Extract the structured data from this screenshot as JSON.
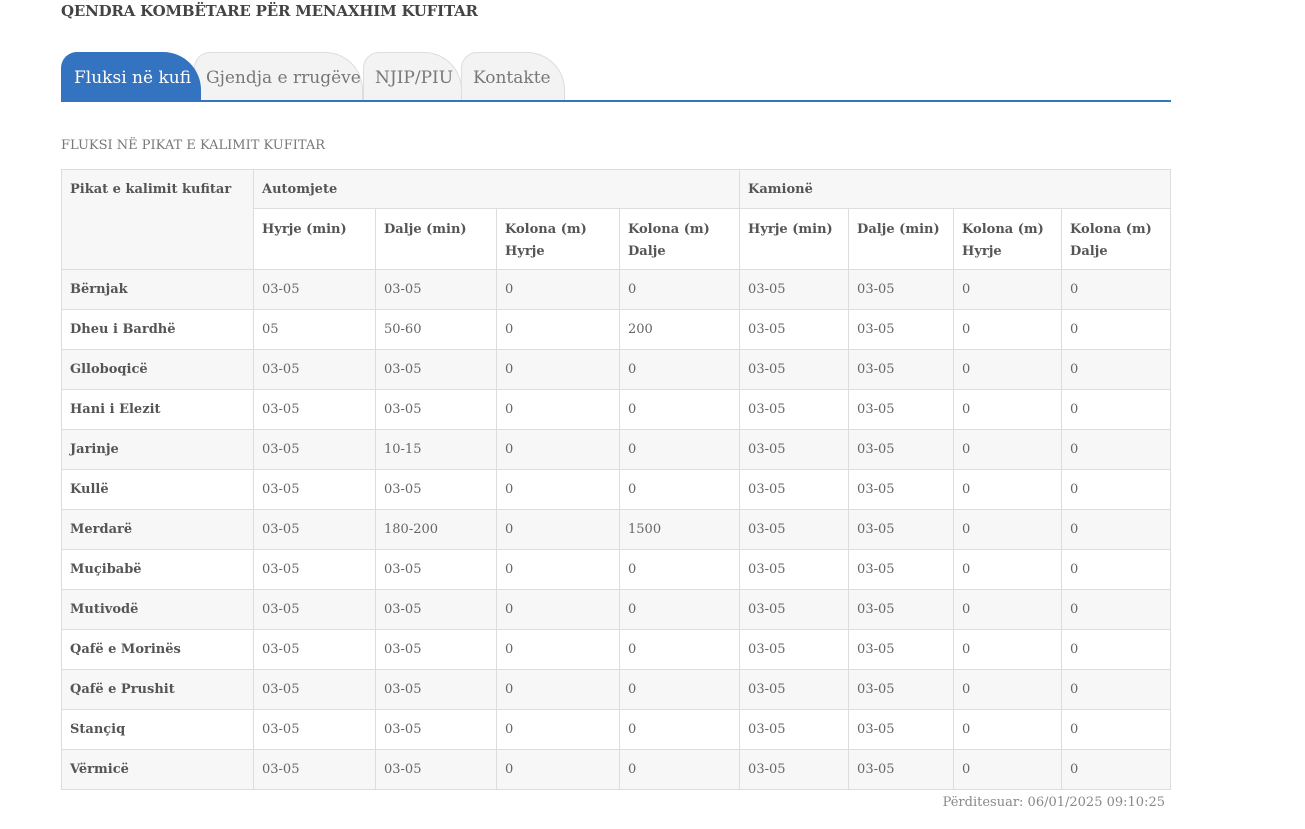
{
  "header": {
    "title": "QENDRA KOMBËTARE PËR MENAXHIM KUFITAR"
  },
  "tabs": [
    {
      "label": "Fluksi në kufi",
      "active": true
    },
    {
      "label": "Gjendja e rrugëve",
      "active": false
    },
    {
      "label": "NJIP/PIU",
      "active": false
    },
    {
      "label": "Kontakte",
      "active": false
    }
  ],
  "section_title": "FLUKSI NË PIKAT E KALIMIT KUFITAR",
  "table": {
    "first_header": "Pikat e kalimit kufitar",
    "groups": [
      "Automjete",
      "Kamionë"
    ],
    "columns": [
      "Hyrje (min)",
      "Dalje (min)",
      "Kolona (m) Hyrje",
      "Kolona (m) Dalje",
      "Hyrje (min)",
      "Dalje (min)",
      "Kolona (m) Hyrje",
      "Kolona (m) Dalje"
    ],
    "rows": [
      {
        "name": "Bërnjak",
        "values": [
          "03-05",
          "03-05",
          "0",
          "0",
          "03-05",
          "03-05",
          "0",
          "0"
        ]
      },
      {
        "name": "Dheu i Bardhë",
        "values": [
          "05",
          "50-60",
          "0",
          "200",
          "03-05",
          "03-05",
          "0",
          "0"
        ]
      },
      {
        "name": "Glloboqicë",
        "values": [
          "03-05",
          "03-05",
          "0",
          "0",
          "03-05",
          "03-05",
          "0",
          "0"
        ]
      },
      {
        "name": "Hani i Elezit",
        "values": [
          "03-05",
          "03-05",
          "0",
          "0",
          "03-05",
          "03-05",
          "0",
          "0"
        ]
      },
      {
        "name": "Jarinje",
        "values": [
          "03-05",
          "10-15",
          "0",
          "0",
          "03-05",
          "03-05",
          "0",
          "0"
        ]
      },
      {
        "name": "Kullë",
        "values": [
          "03-05",
          "03-05",
          "0",
          "0",
          "03-05",
          "03-05",
          "0",
          "0"
        ]
      },
      {
        "name": "Merdarë",
        "values": [
          "03-05",
          "180-200",
          "0",
          "1500",
          "03-05",
          "03-05",
          "0",
          "0"
        ]
      },
      {
        "name": "Muçibabë",
        "values": [
          "03-05",
          "03-05",
          "0",
          "0",
          "03-05",
          "03-05",
          "0",
          "0"
        ]
      },
      {
        "name": "Mutivodë",
        "values": [
          "03-05",
          "03-05",
          "0",
          "0",
          "03-05",
          "03-05",
          "0",
          "0"
        ]
      },
      {
        "name": "Qafë e Morinës",
        "values": [
          "03-05",
          "03-05",
          "0",
          "0",
          "03-05",
          "03-05",
          "0",
          "0"
        ]
      },
      {
        "name": "Qafë e Prushit",
        "values": [
          "03-05",
          "03-05",
          "0",
          "0",
          "03-05",
          "03-05",
          "0",
          "0"
        ]
      },
      {
        "name": "Stançiq",
        "values": [
          "03-05",
          "03-05",
          "0",
          "0",
          "03-05",
          "03-05",
          "0",
          "0"
        ]
      },
      {
        "name": "Vërmicë",
        "values": [
          "03-05",
          "03-05",
          "0",
          "0",
          "03-05",
          "03-05",
          "0",
          "0"
        ]
      }
    ]
  },
  "footer": {
    "updated": "Përditesuar: 06/01/2025 09:10:25"
  },
  "colors": {
    "accent": "#3373bf",
    "border": "#dddddd",
    "stripe": "#f7f7f7"
  }
}
